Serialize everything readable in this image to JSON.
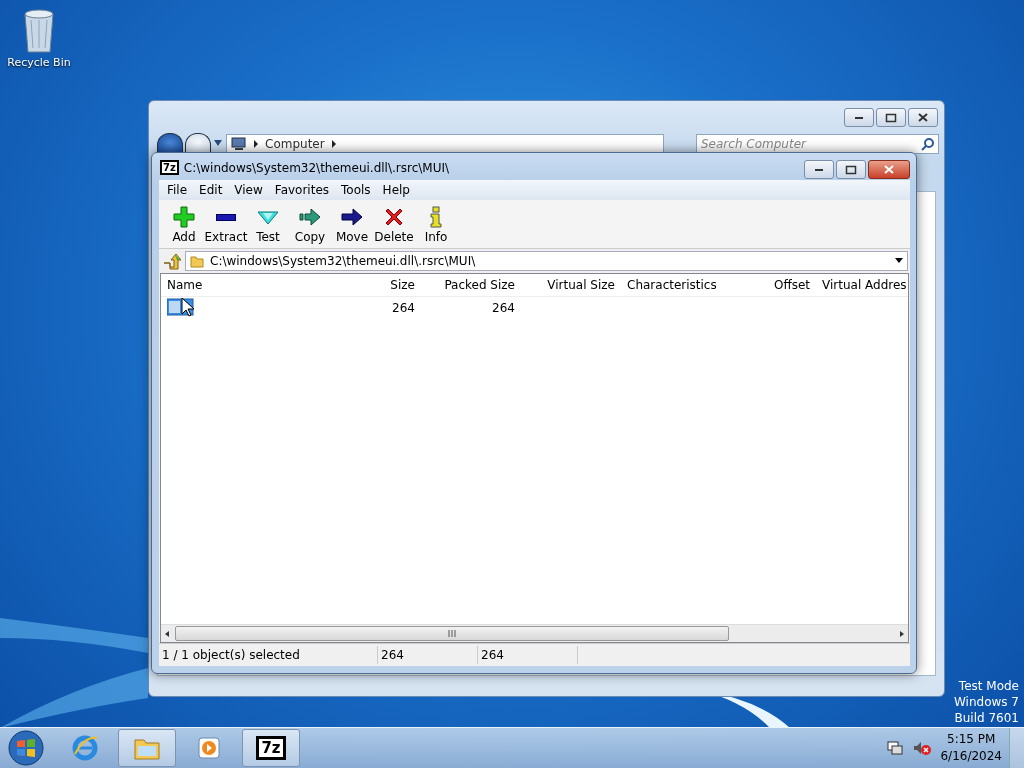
{
  "desktop_icons": [
    {
      "label": "Recycle Bin"
    }
  ],
  "explorer": {
    "breadcrumb": "Computer",
    "search": {
      "placeholder": "Search Computer"
    }
  },
  "window": {
    "logo": "7z",
    "title": "C:\\windows\\System32\\themeui.dll\\.rsrc\\MUI\\"
  },
  "menu": [
    "File",
    "Edit",
    "View",
    "Favorites",
    "Tools",
    "Help"
  ],
  "toolbar": [
    {
      "label": "Add",
      "kind": "add"
    },
    {
      "label": "Extract",
      "kind": "extract"
    },
    {
      "label": "Test",
      "kind": "test"
    },
    {
      "label": "Copy",
      "kind": "copy"
    },
    {
      "label": "Move",
      "kind": "move"
    },
    {
      "label": "Delete",
      "kind": "delete"
    },
    {
      "label": "Info",
      "kind": "info"
    }
  ],
  "address": "C:\\windows\\System32\\themeui.dll\\.rsrc\\MUI\\",
  "table": {
    "columns": [
      {
        "label": "Name"
      },
      {
        "label": "Size"
      },
      {
        "label": "Packed Size"
      },
      {
        "label": "Virtual Size"
      },
      {
        "label": "Characteristics"
      },
      {
        "label": "Offset"
      },
      {
        "label": "Virtual Addres"
      }
    ],
    "rows": [
      {
        "selected": true,
        "size": "264",
        "packed_size": "264"
      }
    ]
  },
  "status_bar": [
    "1 / 1 object(s) selected",
    "264",
    "264"
  ],
  "test_mode": [
    "Test Mode",
    "Windows 7",
    "Build 7601"
  ],
  "taskbar": {
    "apps": [
      {
        "kind": "browser",
        "selected": false
      },
      {
        "kind": "folder",
        "selected": true
      },
      {
        "kind": "media",
        "selected": false
      },
      {
        "kind": "archiver",
        "selected": true,
        "logo": "7z"
      }
    ],
    "time": "5:15 PM",
    "date": "6/16/2024"
  }
}
